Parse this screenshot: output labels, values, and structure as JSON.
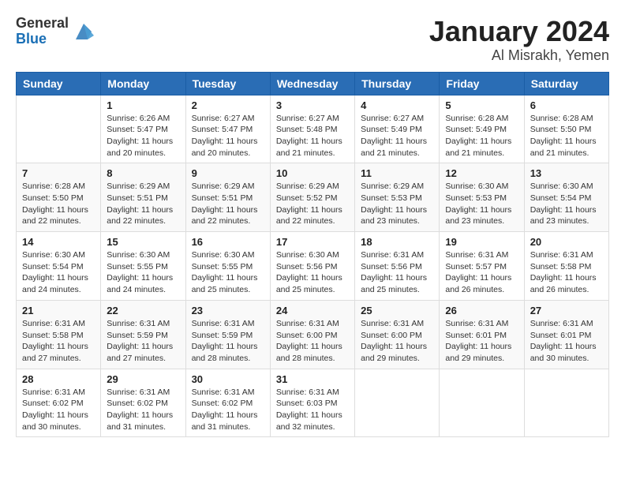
{
  "header": {
    "logo_general": "General",
    "logo_blue": "Blue",
    "title": "January 2024",
    "subtitle": "Al Misrakh, Yemen"
  },
  "calendar": {
    "days_of_week": [
      "Sunday",
      "Monday",
      "Tuesday",
      "Wednesday",
      "Thursday",
      "Friday",
      "Saturday"
    ],
    "weeks": [
      [
        {
          "day": "",
          "info": ""
        },
        {
          "day": "1",
          "info": "Sunrise: 6:26 AM\nSunset: 5:47 PM\nDaylight: 11 hours\nand 20 minutes."
        },
        {
          "day": "2",
          "info": "Sunrise: 6:27 AM\nSunset: 5:47 PM\nDaylight: 11 hours\nand 20 minutes."
        },
        {
          "day": "3",
          "info": "Sunrise: 6:27 AM\nSunset: 5:48 PM\nDaylight: 11 hours\nand 21 minutes."
        },
        {
          "day": "4",
          "info": "Sunrise: 6:27 AM\nSunset: 5:49 PM\nDaylight: 11 hours\nand 21 minutes."
        },
        {
          "day": "5",
          "info": "Sunrise: 6:28 AM\nSunset: 5:49 PM\nDaylight: 11 hours\nand 21 minutes."
        },
        {
          "day": "6",
          "info": "Sunrise: 6:28 AM\nSunset: 5:50 PM\nDaylight: 11 hours\nand 21 minutes."
        }
      ],
      [
        {
          "day": "7",
          "info": "Sunrise: 6:28 AM\nSunset: 5:50 PM\nDaylight: 11 hours\nand 22 minutes."
        },
        {
          "day": "8",
          "info": "Sunrise: 6:29 AM\nSunset: 5:51 PM\nDaylight: 11 hours\nand 22 minutes."
        },
        {
          "day": "9",
          "info": "Sunrise: 6:29 AM\nSunset: 5:51 PM\nDaylight: 11 hours\nand 22 minutes."
        },
        {
          "day": "10",
          "info": "Sunrise: 6:29 AM\nSunset: 5:52 PM\nDaylight: 11 hours\nand 22 minutes."
        },
        {
          "day": "11",
          "info": "Sunrise: 6:29 AM\nSunset: 5:53 PM\nDaylight: 11 hours\nand 23 minutes."
        },
        {
          "day": "12",
          "info": "Sunrise: 6:30 AM\nSunset: 5:53 PM\nDaylight: 11 hours\nand 23 minutes."
        },
        {
          "day": "13",
          "info": "Sunrise: 6:30 AM\nSunset: 5:54 PM\nDaylight: 11 hours\nand 23 minutes."
        }
      ],
      [
        {
          "day": "14",
          "info": "Sunrise: 6:30 AM\nSunset: 5:54 PM\nDaylight: 11 hours\nand 24 minutes."
        },
        {
          "day": "15",
          "info": "Sunrise: 6:30 AM\nSunset: 5:55 PM\nDaylight: 11 hours\nand 24 minutes."
        },
        {
          "day": "16",
          "info": "Sunrise: 6:30 AM\nSunset: 5:55 PM\nDaylight: 11 hours\nand 25 minutes."
        },
        {
          "day": "17",
          "info": "Sunrise: 6:30 AM\nSunset: 5:56 PM\nDaylight: 11 hours\nand 25 minutes."
        },
        {
          "day": "18",
          "info": "Sunrise: 6:31 AM\nSunset: 5:56 PM\nDaylight: 11 hours\nand 25 minutes."
        },
        {
          "day": "19",
          "info": "Sunrise: 6:31 AM\nSunset: 5:57 PM\nDaylight: 11 hours\nand 26 minutes."
        },
        {
          "day": "20",
          "info": "Sunrise: 6:31 AM\nSunset: 5:58 PM\nDaylight: 11 hours\nand 26 minutes."
        }
      ],
      [
        {
          "day": "21",
          "info": "Sunrise: 6:31 AM\nSunset: 5:58 PM\nDaylight: 11 hours\nand 27 minutes."
        },
        {
          "day": "22",
          "info": "Sunrise: 6:31 AM\nSunset: 5:59 PM\nDaylight: 11 hours\nand 27 minutes."
        },
        {
          "day": "23",
          "info": "Sunrise: 6:31 AM\nSunset: 5:59 PM\nDaylight: 11 hours\nand 28 minutes."
        },
        {
          "day": "24",
          "info": "Sunrise: 6:31 AM\nSunset: 6:00 PM\nDaylight: 11 hours\nand 28 minutes."
        },
        {
          "day": "25",
          "info": "Sunrise: 6:31 AM\nSunset: 6:00 PM\nDaylight: 11 hours\nand 29 minutes."
        },
        {
          "day": "26",
          "info": "Sunrise: 6:31 AM\nSunset: 6:01 PM\nDaylight: 11 hours\nand 29 minutes."
        },
        {
          "day": "27",
          "info": "Sunrise: 6:31 AM\nSunset: 6:01 PM\nDaylight: 11 hours\nand 30 minutes."
        }
      ],
      [
        {
          "day": "28",
          "info": "Sunrise: 6:31 AM\nSunset: 6:02 PM\nDaylight: 11 hours\nand 30 minutes."
        },
        {
          "day": "29",
          "info": "Sunrise: 6:31 AM\nSunset: 6:02 PM\nDaylight: 11 hours\nand 31 minutes."
        },
        {
          "day": "30",
          "info": "Sunrise: 6:31 AM\nSunset: 6:02 PM\nDaylight: 11 hours\nand 31 minutes."
        },
        {
          "day": "31",
          "info": "Sunrise: 6:31 AM\nSunset: 6:03 PM\nDaylight: 11 hours\nand 32 minutes."
        },
        {
          "day": "",
          "info": ""
        },
        {
          "day": "",
          "info": ""
        },
        {
          "day": "",
          "info": ""
        }
      ]
    ]
  }
}
